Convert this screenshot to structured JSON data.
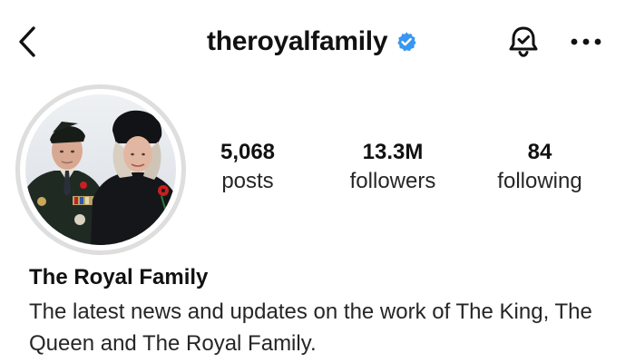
{
  "header": {
    "username": "theroyalfamily",
    "verified_color": "#3897f0",
    "back_icon": "chevron-left-icon",
    "notification_icon": "bell-check-icon",
    "more_icon": "more-horizontal-icon"
  },
  "profile": {
    "avatar_alt": "profile-photo",
    "display_name": "The Royal Family",
    "bio": "The latest news and updates on the work of The King, The Queen and The Royal Family."
  },
  "stats": [
    {
      "value": "5,068",
      "label": "posts"
    },
    {
      "value": "13.3M",
      "label": "followers"
    },
    {
      "value": "84",
      "label": "following"
    }
  ]
}
